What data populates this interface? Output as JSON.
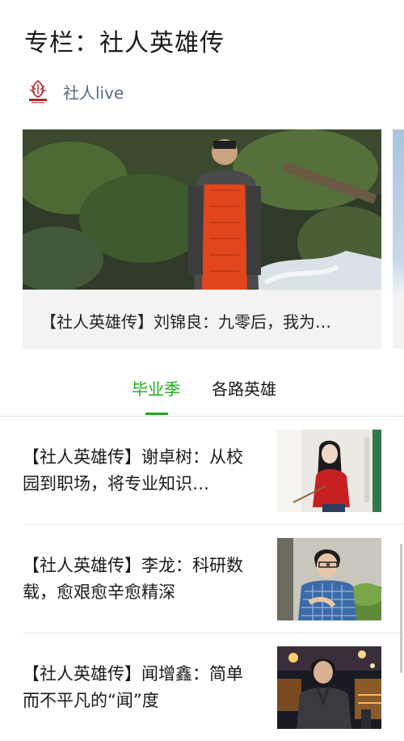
{
  "header": {
    "title": "专栏：社人英雄传"
  },
  "account": {
    "name": "社人live",
    "logo_icon": "school-seal-icon"
  },
  "carousel": {
    "cards": [
      {
        "title": "【社人英雄传】刘锦良：九零后，我为…"
      }
    ]
  },
  "tabs": [
    {
      "label": "毕业季",
      "active": true
    },
    {
      "label": "各路英雄",
      "active": false
    }
  ],
  "colors": {
    "accent": "#1aad19",
    "account_name": "#5a6b86"
  },
  "articles": [
    {
      "title": "【社人英雄传】谢卓树：从校园到职场，将专业知识…"
    },
    {
      "title": "【社人英雄传】李龙：科研数载，愈艰愈辛愈精深"
    },
    {
      "title": "【社人英雄传】闻增鑫：简单而不平凡的“闻”度"
    }
  ]
}
